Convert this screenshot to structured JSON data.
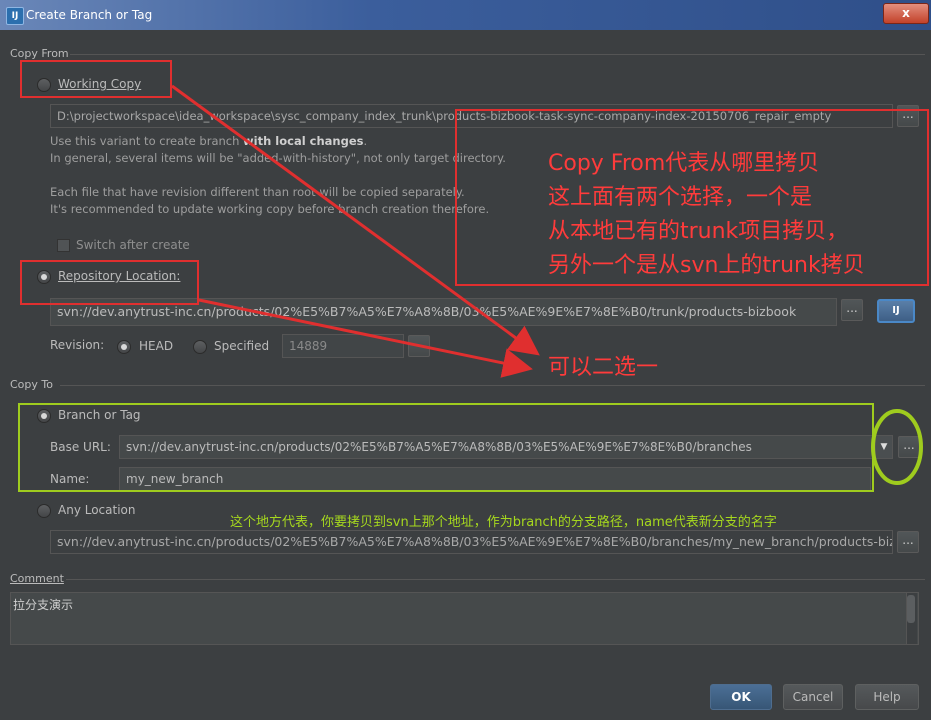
{
  "window": {
    "title": "Create Branch or Tag",
    "app_icon": "intellij-icon",
    "close_label": "x"
  },
  "copy_from": {
    "group_title": "Copy From",
    "working_copy": {
      "label": "Working Copy",
      "selected": false,
      "path": "D:\\projectworkspace\\idea_workspace\\sysc_company_index_trunk\\products-bizbook-task-sync-company-index-20150706_repair_empty",
      "browse_label": "...",
      "hint_line1_pre": "Use this variant to create branch ",
      "hint_line1_bold": "with local changes",
      "hint_line1_post": ".",
      "hint_line2": "In general, several items will be \"added-with-history\", not only target directory.",
      "hint_line3": "Each file that have revision different than root will be copied separately.",
      "hint_line4": "It's recommended to update working copy before branch creation therefore."
    },
    "switch_after_create": {
      "label": "Switch after create",
      "checked": false
    },
    "repository_location": {
      "label": "Repository Location:",
      "selected": true,
      "url": "svn://dev.anytrust-inc.cn/products/02%E5%B7%A5%E7%A8%8B/03%E5%AE%9E%E7%8E%B0/trunk/products-bizbook",
      "browse_label": "...",
      "repo_browser_label": "IJ"
    },
    "revision": {
      "label": "Revision:",
      "head_label": "HEAD",
      "head_selected": true,
      "specified_label": "Specified",
      "specified_selected": false,
      "value": "14889"
    }
  },
  "copy_to": {
    "group_title": "Copy To",
    "branch_or_tag": {
      "label": "Branch or Tag",
      "selected": true,
      "base_url_label": "Base URL:",
      "base_url": "svn://dev.anytrust-inc.cn/products/02%E5%B7%A5%E7%A8%8B/03%E5%AE%9E%E7%8E%B0/branches",
      "browse_label": "...",
      "name_label": "Name:",
      "name_value": "my_new_branch"
    },
    "any_location": {
      "label": "Any Location",
      "selected": false,
      "url": "svn://dev.anytrust-inc.cn/products/02%E5%B7%A5%E7%A8%8B/03%E5%AE%9E%E7%8E%B0/branches/my_new_branch/products-bizbook",
      "browse_label": "..."
    }
  },
  "comment": {
    "label": "Comment",
    "value": "拉分支演示"
  },
  "buttons": {
    "ok": "OK",
    "cancel": "Cancel",
    "help": "Help"
  },
  "annotations": {
    "copy_from_note": [
      "Copy From代表从哪里拷贝",
      "这上面有两个选择，一个是",
      "从本地已有的trunk项目拷贝，",
      "另外一个是从svn上的trunk拷贝"
    ],
    "choose_one": "可以二选一",
    "copy_to_note": "这个地方代表，你要拷贝到svn上那个地址，作为branch的分支路径，name代表新分支的名字",
    "colors": {
      "red": "#e02f2f",
      "green": "#9fcc1e"
    }
  }
}
